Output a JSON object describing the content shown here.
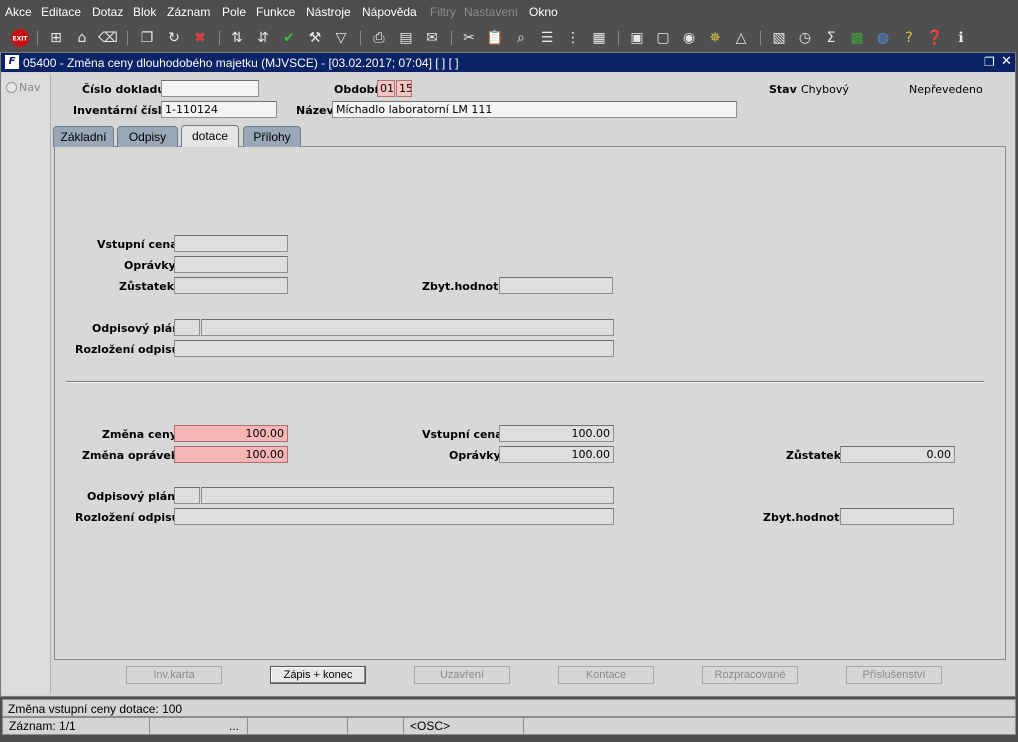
{
  "menu": [
    "Akce",
    "Editace",
    "Dotaz",
    "Blok",
    "Záznam",
    "Pole",
    "Funkce",
    "Nástroje",
    "Nápověda",
    "Filtry",
    "Nastavení",
    "Okno"
  ],
  "toolbar_icons": [
    "exit-icon",
    "add-record-icon",
    "save-icon",
    "clear-icon",
    "copy-icon",
    "refresh-icon",
    "delete-icon",
    "sort-asc-icon",
    "sort-desc-icon",
    "check-icon",
    "wrench-icon",
    "filter-icon",
    "print-icon",
    "print-preview-icon",
    "mail-icon",
    "cut-icon",
    "paste-icon",
    "find-icon",
    "list-icon",
    "tree-icon",
    "calculator-icon",
    "document-icon",
    "globe-icon",
    "gear-icon",
    "warning-icon",
    "chart-icon",
    "clock-icon",
    "sum-icon",
    "excel-icon",
    "web-icon",
    "help-icon",
    "question-icon",
    "info-icon"
  ],
  "window": {
    "title": "05400 - Změna ceny dlouhodobého majetku (MJVSCE) - [03.02.2017; 07:04] [ ] [ ]"
  },
  "nav": {
    "label": "Nav"
  },
  "header": {
    "cislo_dokladu_label": "Číslo dokladu",
    "cislo_dokladu": "",
    "obdobi_label": "Období",
    "obdobi_m": "01",
    "obdobi_y": "15",
    "stav_label": "Stav",
    "stav": "Chybový",
    "prevod": "Nepřevedeno",
    "inventarni_cislo_label": "Inventární číslo",
    "inventarni_cislo": "1-110124",
    "nazev_label": "Název",
    "nazev": "Míchadlo laboratorní LM 111"
  },
  "tabs": [
    "Základní",
    "Odpisy",
    "dotace",
    "Přílohy"
  ],
  "upper": {
    "vstupni_cena_label": "Vstupní cena",
    "opravky_label": "Oprávky",
    "zustatek_label": "Zůstatek",
    "zbyt_hodnota_label": "Zbyt.hodnota",
    "odpisovy_plan_label": "Odpisový plán",
    "rozlozeni_label": "Rozložení odpisů"
  },
  "lower": {
    "zmena_ceny_label": "Změna ceny",
    "zmena_ceny": "100.00",
    "zmena_opravek_label": "Změna oprávek",
    "zmena_opravek": "100.00",
    "vstupni_cena_label": "Vstupní cena",
    "vstupni_cena": "100.00",
    "opravky_label": "Oprávky",
    "opravky": "100.00",
    "zustatek_label": "Zůstatek",
    "zustatek": "0.00",
    "odpisovy_plan_label": "Odpisový plán",
    "rozlozeni_label": "Rozložení odpisů",
    "zbyt_hodnota_label": "Zbyt.hodnota"
  },
  "buttons": [
    "Inv.karta",
    "Zápis + konec",
    "Uzavření",
    "Kontace",
    "Rozpracované",
    "Příslušenství"
  ],
  "status": {
    "message": "Změna vstupní ceny dotace: 100",
    "record": "Záznam: 1/1",
    "dots": "...",
    "mode": "<OSC>"
  }
}
